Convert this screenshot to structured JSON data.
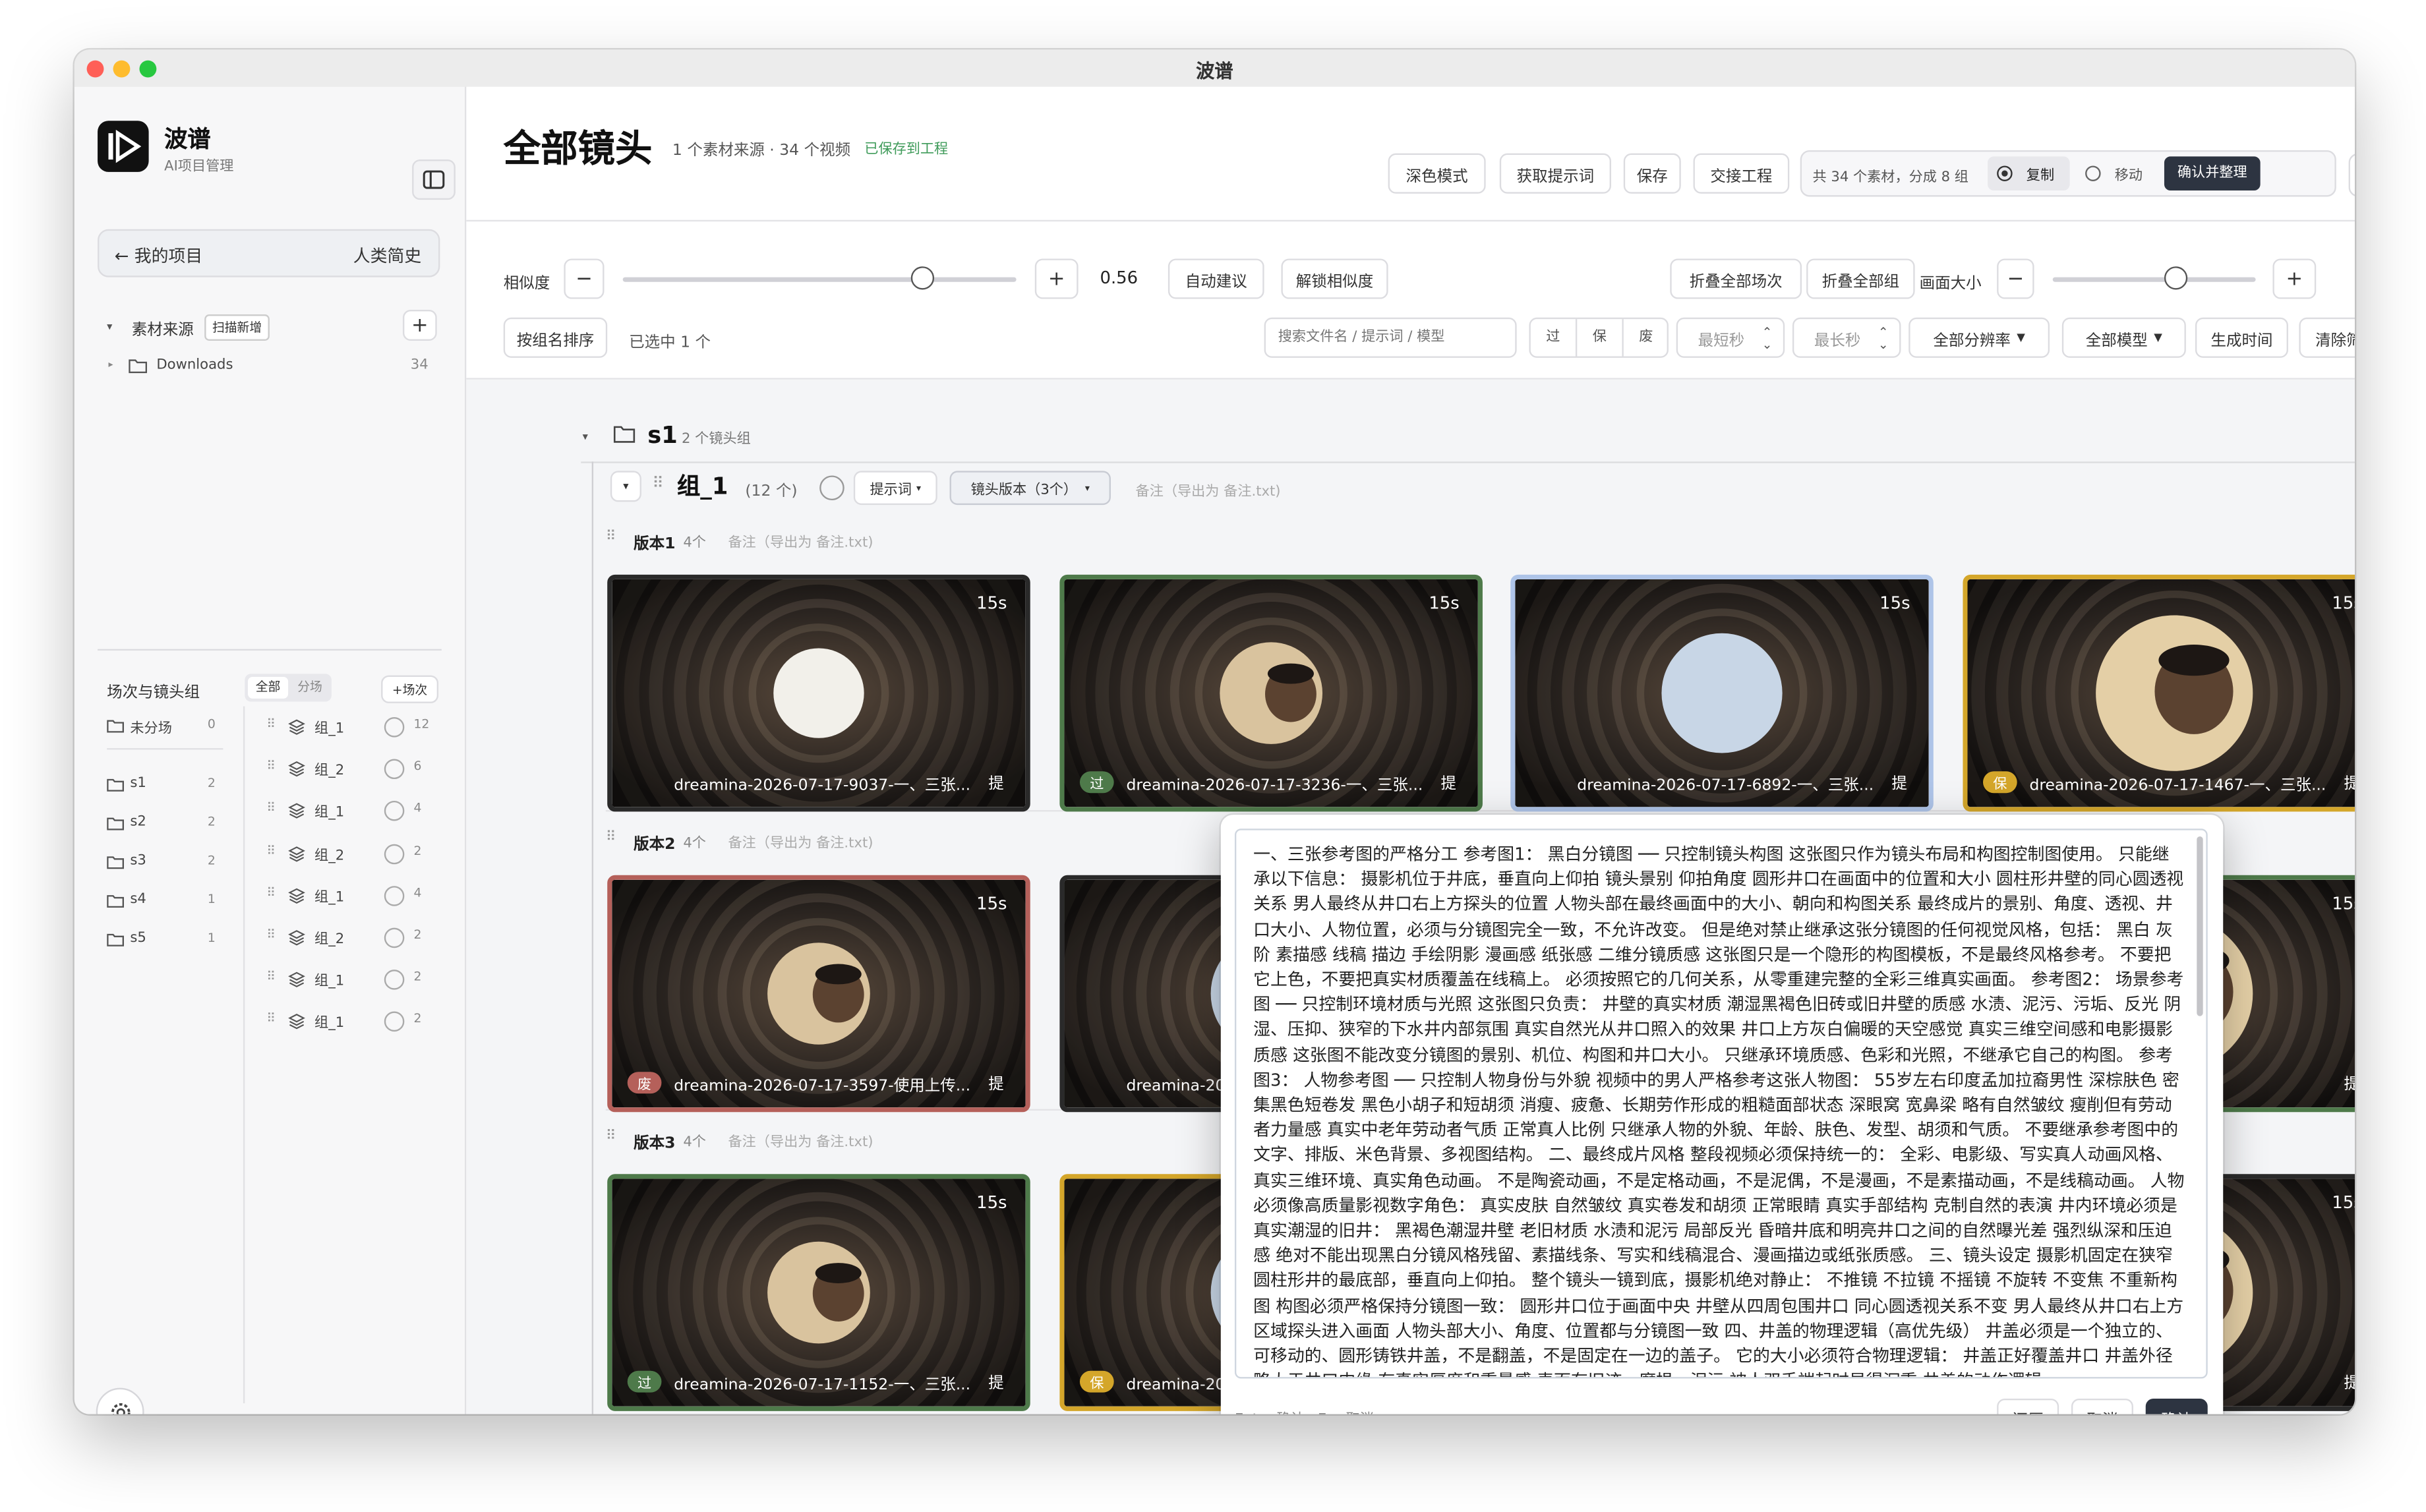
{
  "window": {
    "title": "波谱"
  },
  "app": {
    "name": "波谱",
    "subtitle": "AI项目管理"
  },
  "sidebar": {
    "project_link": "← 我的项目",
    "project_name": "人类简史",
    "source_label": "素材来源",
    "scan_label": "扫描新增",
    "add": "+",
    "downloads": {
      "name": "Downloads",
      "count": "34"
    },
    "scene_header": "场次与镜头组",
    "filter_all": "全部",
    "filter_split": "分场",
    "add_scene": "+场次",
    "scenes": [
      {
        "name": "未分场",
        "count": "0"
      },
      {
        "name": "s1",
        "count": "2"
      },
      {
        "name": "s2",
        "count": "2"
      },
      {
        "name": "s3",
        "count": "2"
      },
      {
        "name": "s4",
        "count": "1"
      },
      {
        "name": "s5",
        "count": "1"
      }
    ],
    "groups": [
      {
        "name": "组_1",
        "count": "12"
      },
      {
        "name": "组_2",
        "count": "6"
      },
      {
        "name": "组_1",
        "count": "4"
      },
      {
        "name": "组_2",
        "count": "2"
      },
      {
        "name": "组_1",
        "count": "4"
      },
      {
        "name": "组_2",
        "count": "2"
      },
      {
        "name": "组_1",
        "count": "2"
      },
      {
        "name": "组_1",
        "count": "2"
      }
    ]
  },
  "header": {
    "title": "全部镜头",
    "meta": "1 个素材来源 · 34 个视频",
    "saved": "已保存到工程",
    "buttons": [
      "深色模式",
      "获取提示词",
      "保存",
      "交接工程"
    ],
    "summary": "共 34 个素材，分成 8 组",
    "copy": "复制",
    "move": "移动",
    "confirm_organize": "确认并整理"
  },
  "toolbar": {
    "similarity_label": "相似度",
    "similarity_value": "0.56",
    "similarity_level": 0.76,
    "minus": "−",
    "plus": "+",
    "auto_suggest": "自动建议",
    "unlock_similar": "解锁相似度",
    "collapse_scenes": "折叠全部场次",
    "collapse_groups": "折叠全部组",
    "frame_size_label": "画面大小",
    "frame_size_level": 0.6,
    "sort_btn": "按组名排序",
    "selected": "已选中 1 个",
    "search_placeholder": "搜索文件名 / 提示词 / 模型",
    "pass": "过",
    "keep": "保",
    "discard": "废",
    "min_sec": "最短秒",
    "max_sec": "最长秒",
    "resolution": "全部分辨率",
    "model": "全部模型",
    "gen_time": "生成时间",
    "clear_filter": "清除筛选"
  },
  "scene": {
    "name": "s1",
    "count": "2 个镜头组"
  },
  "group": {
    "name": "组_1",
    "count": "(12 个)",
    "prompt_btn": "提示词",
    "version_btn": "镜头版本（3个）",
    "note": "备注（导出为 备注.txt)"
  },
  "versions": [
    {
      "label": "版本1",
      "count": "4个",
      "note": "备注（导出为 备注.txt)"
    },
    {
      "label": "版本2",
      "count": "4个",
      "note": "备注（导出为 备注.txt)"
    },
    {
      "label": "版本3",
      "count": "4个",
      "note": "备注（导出为 备注.txt)"
    }
  ],
  "clips": [
    {
      "duration": "15s",
      "name": "dreamina-2026-07-17-9037-一、三张...",
      "badge": "",
      "tag": "提"
    },
    {
      "duration": "15s",
      "name": "dreamina-2026-07-17-3236-一、三张...",
      "badge": "过",
      "tag": "提"
    },
    {
      "duration": "15s",
      "name": "dreamina-2026-07-17-6892-一、三张...",
      "badge": "",
      "tag": "提"
    },
    {
      "duration": "15s",
      "name": "dreamina-2026-07-17-1467-一、三张...",
      "badge": "保",
      "tag": "提"
    },
    {
      "duration": "15s",
      "name": "dreamina-2026-07-17-3597-使用上传...",
      "badge": "废",
      "tag": "提"
    },
    {
      "duration": "15s",
      "name": "dreamina-20",
      "badge": "",
      "tag": ""
    },
    {
      "duration": "15s",
      "name": "95-使用上传...",
      "badge": "",
      "tag": "提"
    },
    {
      "duration": "15s",
      "name": "dreamina-2026-07-17-1152-一、三张...",
      "badge": "过",
      "tag": "提"
    },
    {
      "duration": "15s",
      "name": "dreamina-20",
      "badge": "保",
      "tag": ""
    },
    {
      "duration": "15s",
      "name": "47-一、三张...",
      "badge": "",
      "tag": "提"
    }
  ],
  "popup": {
    "text": "一、三张参考图的严格分工 参考图1： 黑白分镜图 ── 只控制镜头构图 这张图只作为镜头布局和构图控制图使用。 只能继承以下信息： 摄影机位于井底，垂直向上仰拍 镜头景别 仰拍角度 圆形井口在画面中的位置和大小 圆柱形井壁的同心圆透视关系 男人最终从井口右上方探头的位置 人物头部在最终画面中的大小、朝向和构图关系 最终成片的景别、角度、透视、井口大小、人物位置，必须与分镜图完全一致，不允许改变。 但是绝对禁止继承这张分镜图的任何视觉风格，包括： 黑白 灰阶 素描感 线稿 描边 手绘阴影 漫画感 纸张感 二维分镜质感 这张图只是一个隐形的构图模板，不是最终风格参考。 不要把它上色，不要把真实材质覆盖在线稿上。 必须按照它的几何关系，从零重建完整的全彩三维真实画面。 参考图2： 场景参考图 ── 只控制环境材质与光照 这张图只负责： 井壁的真实材质 潮湿黑褐色旧砖或旧井壁的质感 水渍、泥污、污垢、反光 阴湿、压抑、狭窄的下水井内部氛围 真实自然光从井口照入的效果 井口上方灰白偏暖的天空感觉 真实三维空间感和电影摄影质感 这张图不能改变分镜图的景别、机位、构图和井口大小。 只继承环境质感、色彩和光照，不继承它自己的构图。 参考图3： 人物参考图 ── 只控制人物身份与外貌 视频中的男人严格参考这张人物图： 55岁左右印度孟加拉裔男性 深棕肤色 密集黑色短卷发 黑色小胡子和短胡须 消瘦、疲惫、长期劳作形成的粗糙面部状态 深眼窝 宽鼻梁 略有自然皱纹 瘦削但有劳动者力量感 真实中老年劳动者气质 正常真人比例 只继承人物的外貌、年龄、肤色、发型、胡须和气质。 不要继承参考图中的文字、排版、米色背景、多视图结构。 二、最终成片风格 整段视频必须保持统一的： 全彩、电影级、写实真人动画风格、真实三维环境、真实角色动画。 不是陶瓷动画，不是定格动画，不是泥偶，不是漫画，不是素描动画，不是线稿动画。 人物必须像高质量影视数字角色： 真实皮肤 自然皱纹 真实卷发和胡须 正常眼睛 真实手部结构 克制自然的表演 井内环境必须是真实潮湿的旧井： 黑褐色潮湿井壁 老旧材质 水渍和泥污 局部反光 昏暗井底和明亮井口之间的自然曝光差 强烈纵深和压迫感 绝对不能出现黑白分镜风格残留、素描线条、写实和线稿混合、漫画描边或纸张质感。 三、镜头设定 摄影机固定在狭窄圆柱形井的最底部，垂直向上仰拍。 整个镜头一镜到底，摄影机绝对静止： 不推镜 不拉镜 不摇镜 不旋转 不变焦 不重新构图 构图必须严格保持分镜图一致： 圆形井口位于画面中央 井壁从四周包围井口 同心圆透视关系不变 男人最终从井口右上方区域探头进入画面 人物头部大小、角度、位置都与分镜图一致 四、井盖的物理逻辑（高优先级） 井盖必须是一个独立的、可移动的、圆形铸铁井盖，不是翻盖，不是固定在一边的盖子。 它的大小必须符合物理逻辑： 井盖正好覆盖井口 井盖外径略大于井口内缘 有真实厚度和重量感 表面有旧迹、磨损、泥污 被人双手端起时显得沉重 井盖的动作逻辑",
    "hint": "Enter 确认 · Esc 取消",
    "restore": "还原",
    "cancel": "取消",
    "confirm": "确认"
  },
  "colors": {
    "accent": "#2d3441",
    "green": "#4e7a4a",
    "yellow": "#d4a62a",
    "red": "#b5605a",
    "blue": "#aec4e8",
    "saved": "#3f9b5a"
  }
}
